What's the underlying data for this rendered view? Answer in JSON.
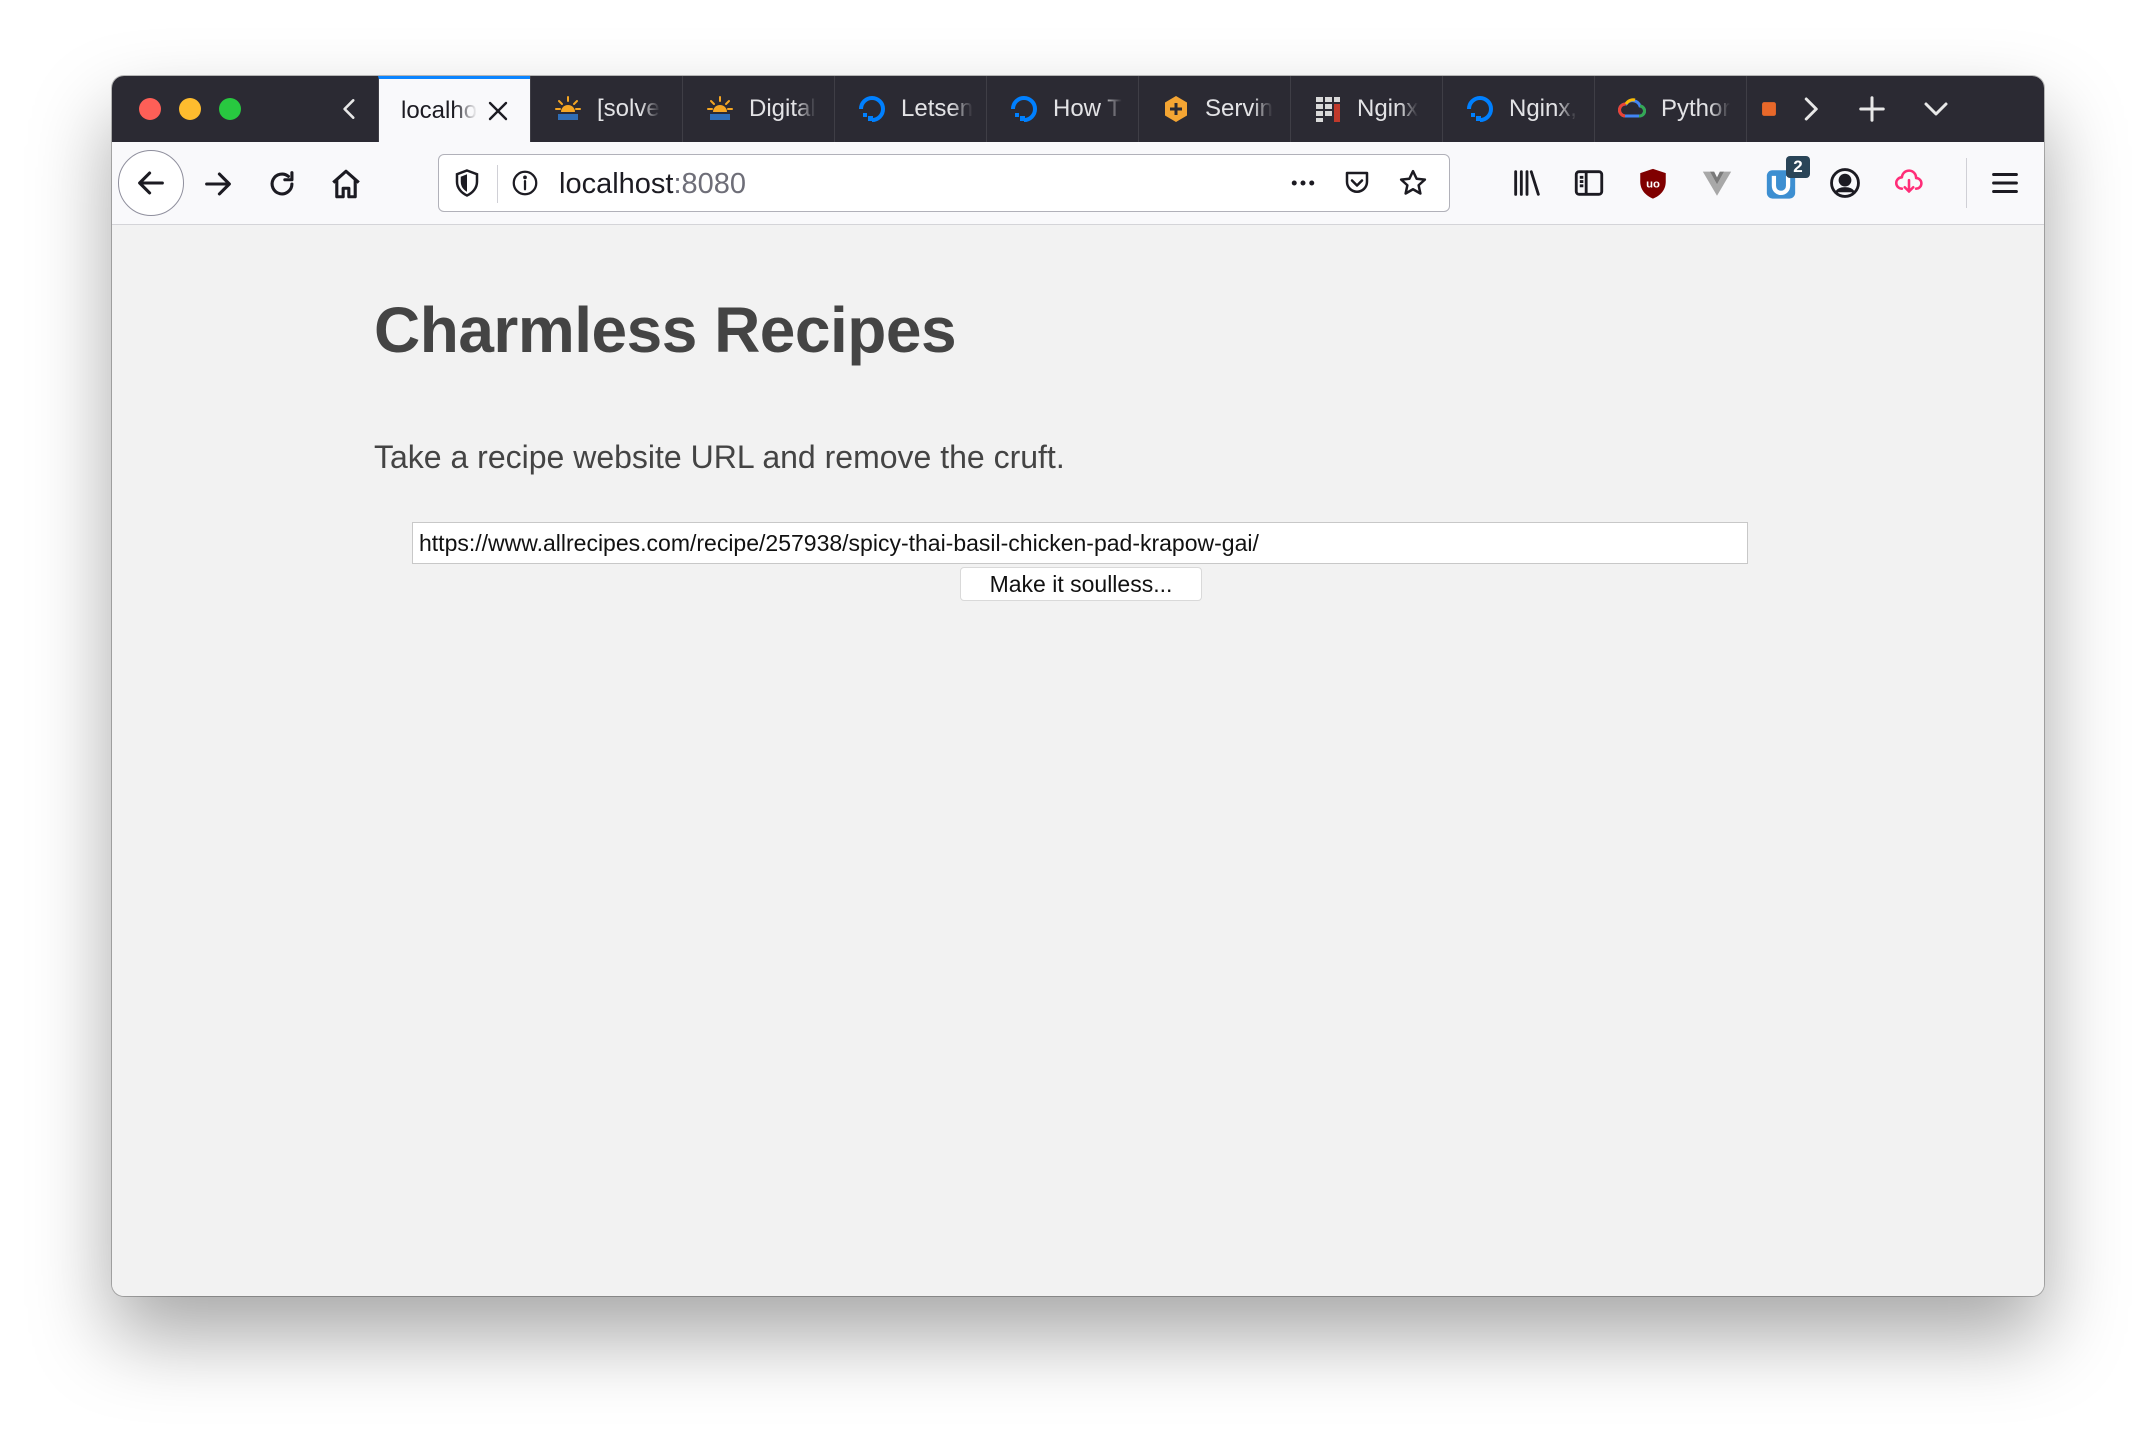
{
  "browser": {
    "tabs": [
      {
        "label": "localho",
        "icon": "blank-page-icon",
        "active": true
      },
      {
        "label": "[solve",
        "icon": "sun-logo-icon"
      },
      {
        "label": "Digital",
        "icon": "sun-logo-icon"
      },
      {
        "label": "Letsen",
        "icon": "digitalocean-icon"
      },
      {
        "label": "How T",
        "icon": "digitalocean-icon"
      },
      {
        "label": "Servin",
        "icon": "hexagon-plus-icon"
      },
      {
        "label": "Nginx",
        "icon": "grid-icon"
      },
      {
        "label": "Nginx,",
        "icon": "digitalocean-icon"
      },
      {
        "label": "Pythor",
        "icon": "google-cloud-icon"
      }
    ],
    "address": {
      "host": "localhost",
      "port": ":8080"
    },
    "extensions": {
      "badge_count": "2"
    }
  },
  "page": {
    "title": "Charmless Recipes",
    "subtitle": "Take a recipe website URL and remove the cruft.",
    "url_value": "https://www.allrecipes.com/recipe/257938/spicy-thai-basil-chicken-pad-krapow-gai/",
    "submit_label": "Make it soulless..."
  },
  "colors": {
    "tabbar": "#2b2a33",
    "active_tab_accent": "#0a84ff",
    "page_background": "#f2f2f2",
    "title_text": "#444444"
  }
}
